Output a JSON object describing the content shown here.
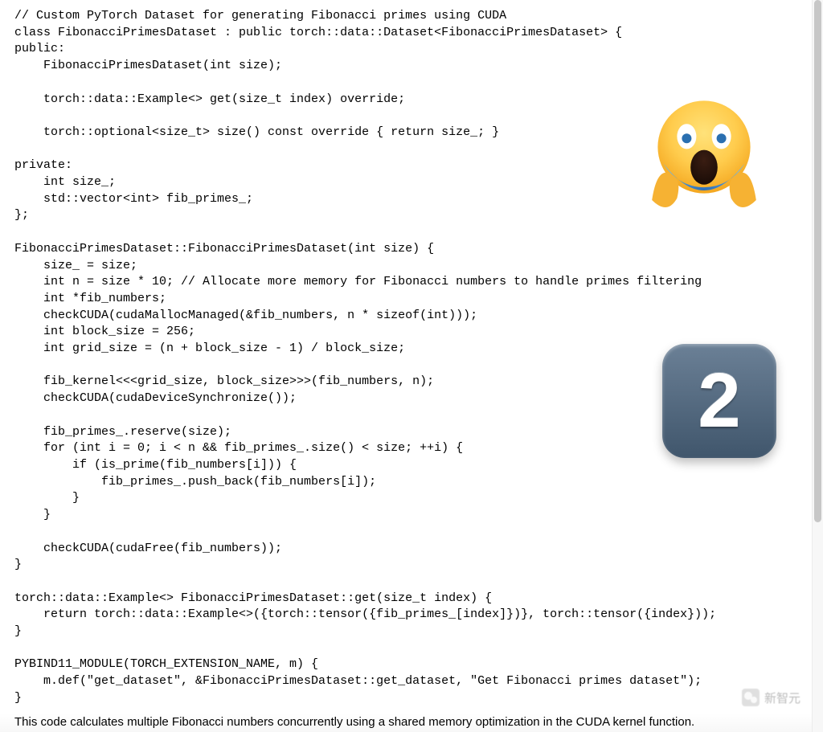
{
  "code_lines": [
    "// Custom PyTorch Dataset for generating Fibonacci primes using CUDA",
    "class FibonacciPrimesDataset : public torch::data::Dataset<FibonacciPrimesDataset> {",
    "public:",
    "    FibonacciPrimesDataset(int size);",
    "",
    "    torch::data::Example<> get(size_t index) override;",
    "",
    "    torch::optional<size_t> size() const override { return size_; }",
    "",
    "private:",
    "    int size_;",
    "    std::vector<int> fib_primes_;",
    "};",
    "",
    "FibonacciPrimesDataset::FibonacciPrimesDataset(int size) {",
    "    size_ = size;",
    "    int n = size * 10; // Allocate more memory for Fibonacci numbers to handle primes filtering",
    "    int *fib_numbers;",
    "    checkCUDA(cudaMallocManaged(&fib_numbers, n * sizeof(int)));",
    "    int block_size = 256;",
    "    int grid_size = (n + block_size - 1) / block_size;",
    "",
    "    fib_kernel<<<grid_size, block_size>>>(fib_numbers, n);",
    "    checkCUDA(cudaDeviceSynchronize());",
    "",
    "    fib_primes_.reserve(size);",
    "    for (int i = 0; i < n && fib_primes_.size() < size; ++i) {",
    "        if (is_prime(fib_numbers[i])) {",
    "            fib_primes_.push_back(fib_numbers[i]);",
    "        }",
    "    }",
    "",
    "    checkCUDA(cudaFree(fib_numbers));",
    "}",
    "",
    "torch::data::Example<> FibonacciPrimesDataset::get(size_t index) {",
    "    return torch::data::Example<>({torch::tensor({fib_primes_[index]})}, torch::tensor({index}));",
    "}",
    "",
    "PYBIND11_MODULE(TORCH_EXTENSION_NAME, m) {",
    "    m.def(\"get_dataset\", &FibonacciPrimesDataset::get_dataset, \"Get Fibonacci primes dataset\");",
    "}"
  ],
  "caption": "This code calculates multiple Fibonacci numbers concurrently using a shared memory optimization in the CUDA kernel function.",
  "overlays": {
    "scream_emoji_alt": "face-screaming-in-fear",
    "number_badge": "2"
  },
  "watermark": "新智元"
}
